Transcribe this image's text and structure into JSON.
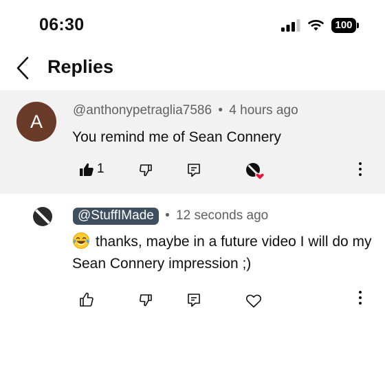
{
  "status_bar": {
    "time": "06:30",
    "battery": "100"
  },
  "header": {
    "title": "Replies",
    "back_icon": "chevron-left-icon"
  },
  "parent_comment": {
    "avatar_letter": "A",
    "avatar_color": "#6b3b2a",
    "author": "@anthonypetraglia7586",
    "separator": "•",
    "time_ago": "4 hours ago",
    "text": "You remind me of Sean Connery",
    "like_count": "1",
    "liked": true,
    "creator_hearted": true,
    "heart_color": "#e8143c"
  },
  "reply_comment": {
    "author": "@StuffIMade",
    "author_is_creator": true,
    "author_chip_color": "#3f4f60",
    "separator": "•",
    "time_ago": "12 seconds ago",
    "emoji": "face-with-tears-of-joy",
    "text": "thanks, maybe in a future video I will do my Sean Connery impression ;)"
  },
  "icons": {
    "like": "thumbs-up-icon",
    "dislike": "thumbs-down-icon",
    "reply": "comment-reply-icon",
    "heart": "heart-icon",
    "more": "more-vertical-icon"
  }
}
